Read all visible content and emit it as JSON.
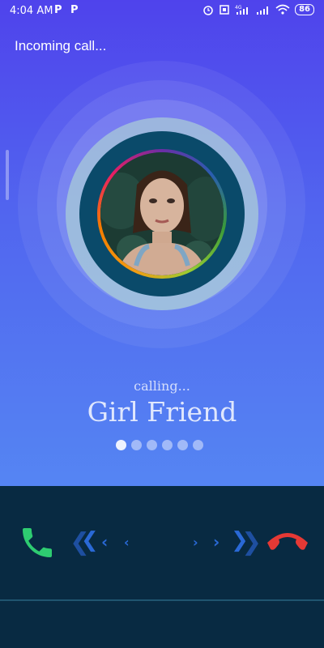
{
  "status_bar": {
    "time": "4:04 AM",
    "notification_icons": [
      "p-icon",
      "p-icon"
    ],
    "battery": "86",
    "right_icons": [
      "alarm-icon",
      "vibrate-icon",
      "signal-4g-icon",
      "signal-icon",
      "wifi-icon",
      "battery-icon"
    ]
  },
  "header": {
    "incoming_label": "Incoming call..."
  },
  "caller": {
    "status": "calling...",
    "name": "Girl Friend",
    "pager": {
      "count": 6,
      "active_index": 0
    }
  },
  "actions": {
    "accept_icon": "phone-accept-icon",
    "decline_icon": "phone-decline-icon",
    "accept_color": "#2ecc71",
    "decline_color": "#e53935",
    "chevron_color": "#2a69d6"
  },
  "colors": {
    "gradient_top": "#4f43ec",
    "gradient_bottom": "#5585f3",
    "bottom_panel": "#082a42"
  }
}
